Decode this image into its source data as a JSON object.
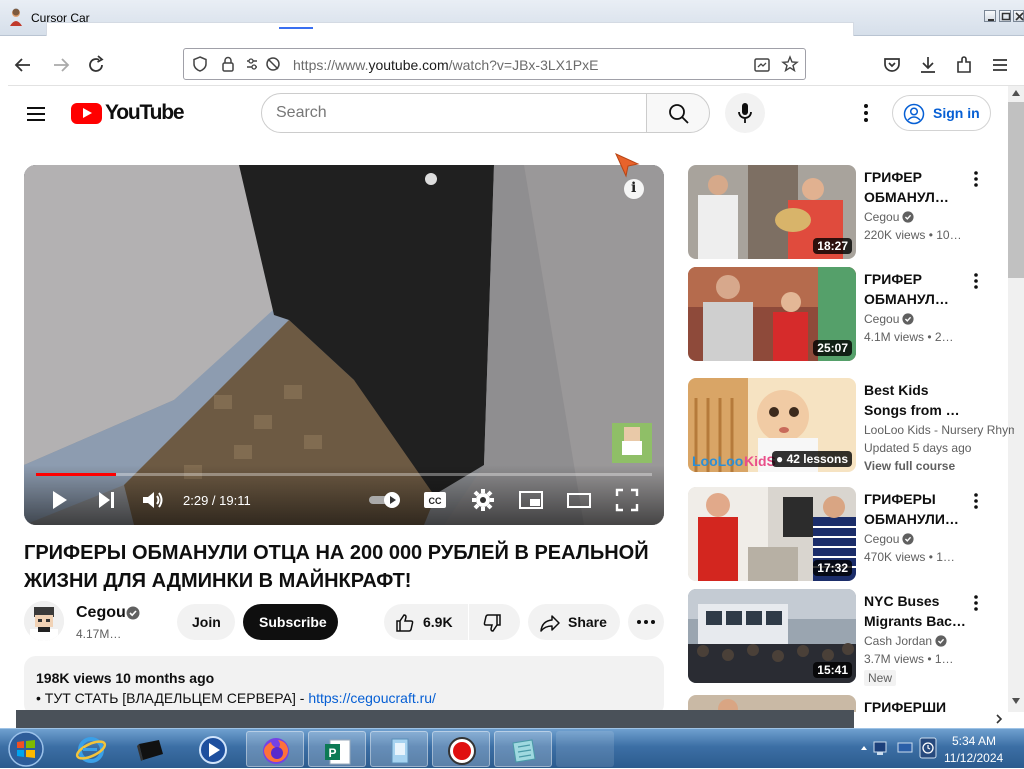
{
  "window": {
    "title": "Cursor Car"
  },
  "browser": {
    "url_prefix": "https://www.",
    "url_host": "youtube.com",
    "url_path": "/watch?v=JBx-3LX1PxE"
  },
  "header": {
    "logo_text": "YouTube",
    "search_placeholder": "Search",
    "sign_in": "Sign in"
  },
  "player": {
    "time": "2:29 / 19:11",
    "progress": 0.13
  },
  "video": {
    "title_line1": "ГРИФЕРЫ ОБМАНУЛИ ОТЦА НА 200 000 РУБЛЕЙ В РЕАЛЬНОЙ",
    "title_line2": "ЖИЗНИ ДЛЯ АДМИНКИ В МАЙНКРАФТ!",
    "channel": "Cegou",
    "subscribers": "4.17M…",
    "join": "Join",
    "subscribe": "Subscribe",
    "likes": "6.9K",
    "share": "Share",
    "meta": "198K views  10 months ago",
    "desc_text": "• ТУТ СТАТЬ [ВЛАДЕЛЬЦЕМ СЕРВЕРА] - ",
    "desc_link": "https://cegoucraft.ru/"
  },
  "recommendations": [
    {
      "title1": "ГРИФЕР",
      "title2": "ОБМАНУЛ…",
      "channel": "Cegou",
      "views": "220K views  • 10…",
      "duration": "18:27"
    },
    {
      "title1": "ГРИФЕР",
      "title2": "ОБМАНУЛ…",
      "channel": "Cegou",
      "views": "4.1M views  • 2…",
      "duration": "25:07"
    },
    {
      "title1": "Best Kids",
      "title2": "Songs from …",
      "channel": "LooLoo Kids - Nursery Rhym",
      "views": "Updated 5 days ago",
      "link": "View full course",
      "duration": "42 lessons"
    },
    {
      "title1": "ГРИФЕРЫ",
      "title2": "ОБМАНУЛИ…",
      "channel": "Cegou",
      "views": "470K views  • 1…",
      "duration": "17:32"
    },
    {
      "title1": "NYC Buses",
      "title2": "Migrants Bac…",
      "channel": "Cash Jordan",
      "views": "3.7M views  • 1…",
      "badge": "New",
      "duration": "15:41"
    },
    {
      "title1": "ГРИФЕРШИ",
      "title2": "",
      "channel": "",
      "views": "",
      "duration": ""
    }
  ],
  "taskbar": {
    "time": "5:34 AM",
    "date": "11/12/2024"
  },
  "colors": {
    "accent_red": "#ff0000",
    "link_blue": "#065fd4"
  }
}
